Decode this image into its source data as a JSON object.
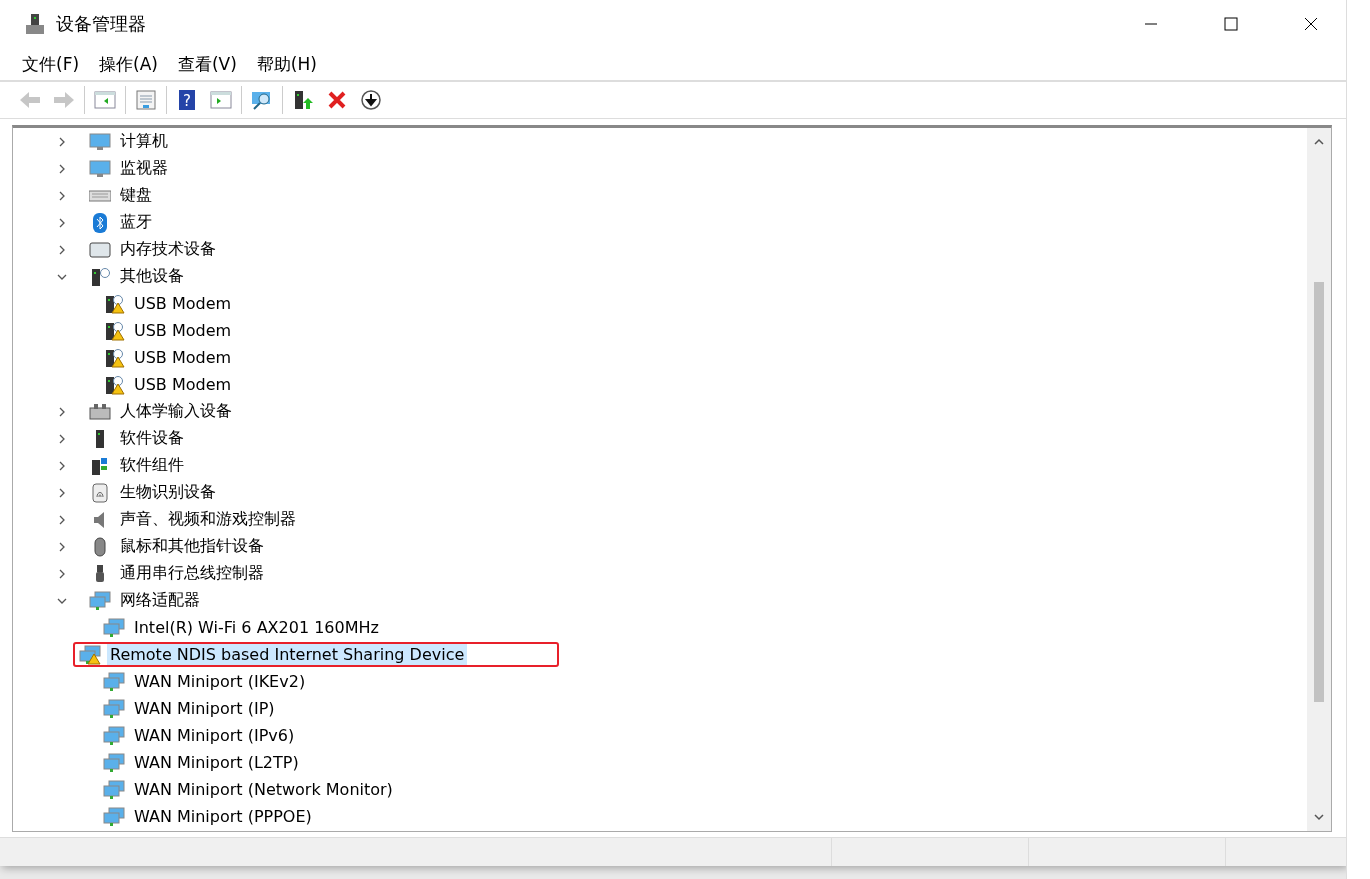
{
  "window": {
    "title": "设备管理器"
  },
  "menu": [
    "文件(F)",
    "操作(A)",
    "查看(V)",
    "帮助(H)"
  ],
  "toolbar": [
    {
      "kind": "back",
      "disabled": true
    },
    {
      "kind": "forward",
      "disabled": true
    },
    {
      "kind": "sep"
    },
    {
      "kind": "tree"
    },
    {
      "kind": "sep"
    },
    {
      "kind": "properties"
    },
    {
      "kind": "sep"
    },
    {
      "kind": "help",
      "glyph": "?"
    },
    {
      "kind": "pane"
    },
    {
      "kind": "sep"
    },
    {
      "kind": "scan"
    },
    {
      "kind": "sep"
    },
    {
      "kind": "update"
    },
    {
      "kind": "uninstall"
    },
    {
      "kind": "disable"
    }
  ],
  "tree": [
    {
      "label": "计算机",
      "kind": "monitor",
      "expanded": false
    },
    {
      "label": "监视器",
      "kind": "monitor",
      "expanded": false
    },
    {
      "label": "键盘",
      "kind": "keyboard",
      "expanded": false
    },
    {
      "label": "蓝牙",
      "kind": "bluetooth",
      "expanded": false
    },
    {
      "label": "内存技术设备",
      "kind": "memory",
      "expanded": false
    },
    {
      "label": "其他设备",
      "kind": "other",
      "expanded": true,
      "children": [
        {
          "label": "USB Modem",
          "kind": "modem",
          "warning": true,
          "selected": false,
          "marked": false
        },
        {
          "label": "USB Modem",
          "kind": "modem",
          "warning": true,
          "selected": false,
          "marked": false
        },
        {
          "label": "USB Modem",
          "kind": "modem",
          "warning": true,
          "selected": false,
          "marked": false
        },
        {
          "label": "USB Modem",
          "kind": "modem",
          "warning": true,
          "selected": false,
          "marked": false
        }
      ]
    },
    {
      "label": "人体学输入设备",
      "kind": "hid",
      "expanded": false
    },
    {
      "label": "软件设备",
      "kind": "device",
      "expanded": false
    },
    {
      "label": "软件组件",
      "kind": "component",
      "expanded": false
    },
    {
      "label": "生物识别设备",
      "kind": "fingerprint",
      "expanded": false
    },
    {
      "label": "声音、视频和游戏控制器",
      "kind": "sound",
      "expanded": false
    },
    {
      "label": "鼠标和其他指针设备",
      "kind": "mouse",
      "expanded": false
    },
    {
      "label": "通用串行总线控制器",
      "kind": "usb",
      "expanded": false
    },
    {
      "label": "网络适配器",
      "kind": "network",
      "expanded": true,
      "children": [
        {
          "label": "Intel(R) Wi-Fi 6 AX201 160MHz",
          "kind": "network",
          "warning": false,
          "selected": false,
          "marked": false
        },
        {
          "label": "Remote NDIS based Internet Sharing Device",
          "kind": "network",
          "warning": true,
          "selected": true,
          "marked": true
        },
        {
          "label": "WAN Miniport (IKEv2)",
          "kind": "network",
          "warning": false,
          "selected": false,
          "marked": false
        },
        {
          "label": "WAN Miniport (IP)",
          "kind": "network",
          "warning": false,
          "selected": false,
          "marked": false
        },
        {
          "label": "WAN Miniport (IPv6)",
          "kind": "network",
          "warning": false,
          "selected": false,
          "marked": false
        },
        {
          "label": "WAN Miniport (L2TP)",
          "kind": "network",
          "warning": false,
          "selected": false,
          "marked": false
        },
        {
          "label": "WAN Miniport (Network Monitor)",
          "kind": "network",
          "warning": false,
          "selected": false,
          "marked": false
        },
        {
          "label": "WAN Miniport (PPPOE)",
          "kind": "network",
          "warning": false,
          "selected": false,
          "marked": false
        }
      ]
    }
  ]
}
